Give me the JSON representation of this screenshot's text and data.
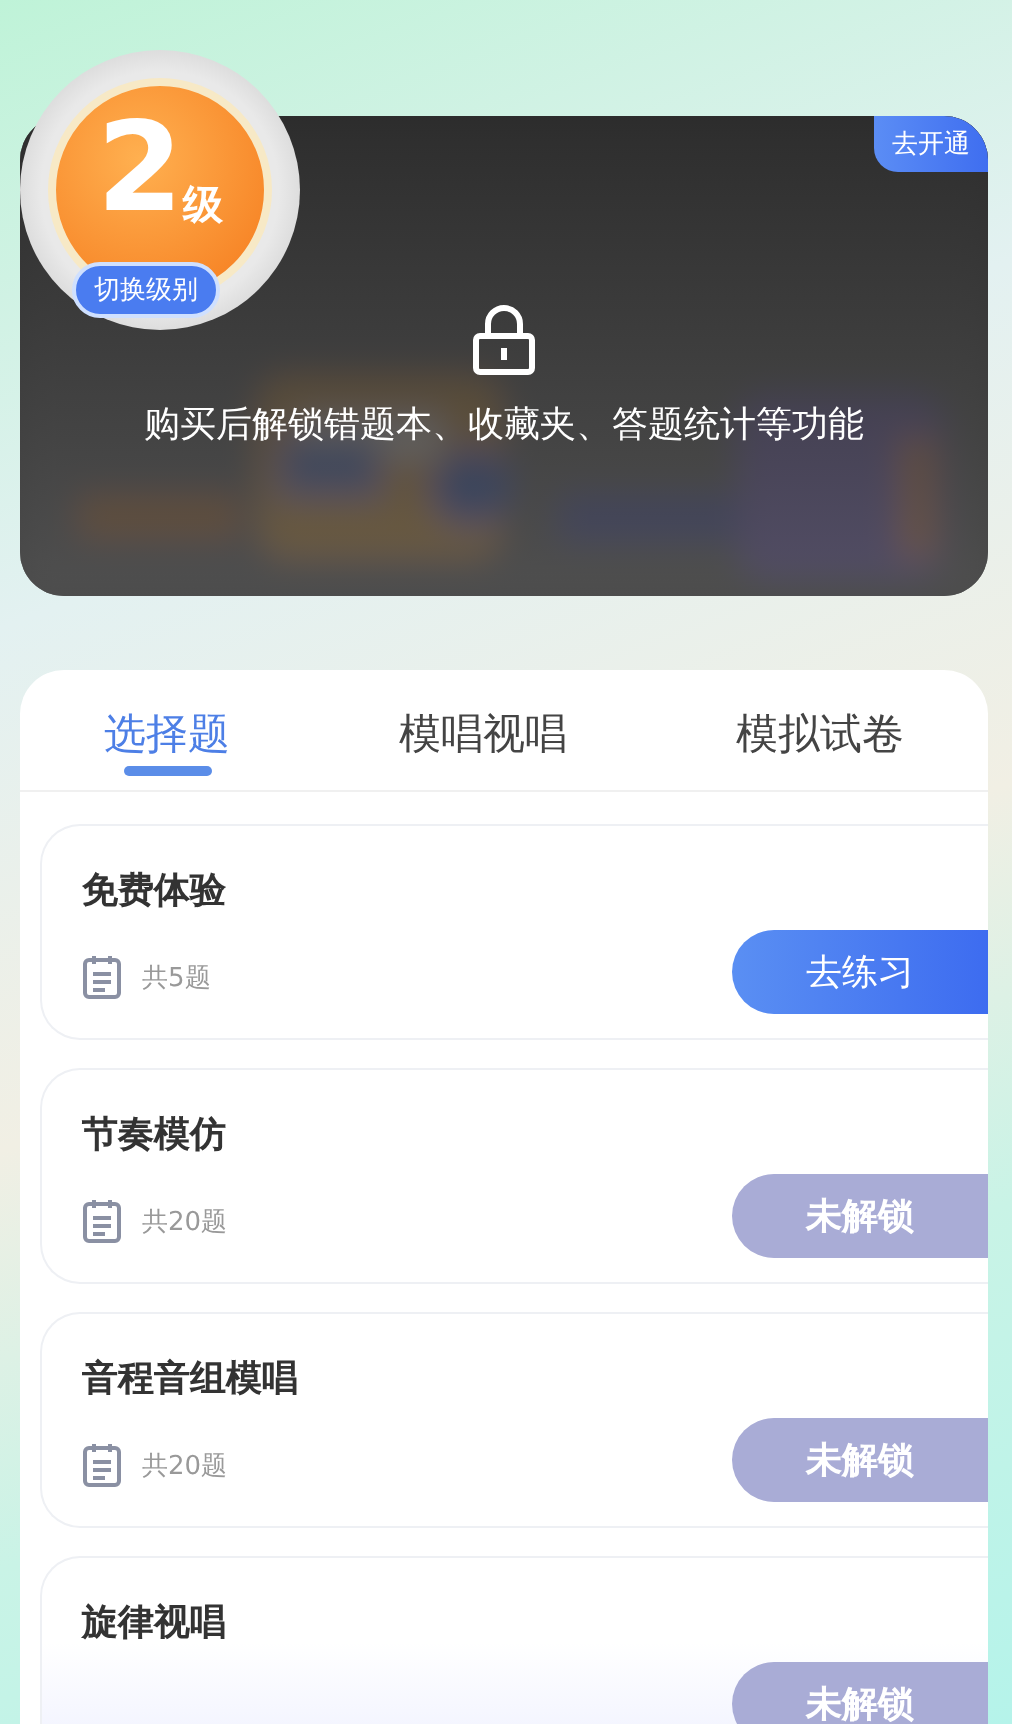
{
  "level_badge": {
    "number": "2",
    "unit": "级",
    "switch_label": "切换级别"
  },
  "banner": {
    "kind": "picture",
    "open_button": "去开通",
    "locked": true,
    "message": "购买后解锁错题本、收藏夹、答题统计等功能"
  },
  "tabs": [
    {
      "label": "选择题",
      "selected": true
    },
    {
      "label": "模唱视唱",
      "selected": false
    },
    {
      "label": "模拟试卷",
      "selected": false
    }
  ],
  "sets": [
    {
      "title": "免费体验",
      "count": "共5题",
      "button": "去练习",
      "locked": false
    },
    {
      "title": "节奏模仿",
      "count": "共20题",
      "button": "未解锁",
      "locked": true
    },
    {
      "title": "音程音组模唱",
      "count": "共20题",
      "button": "未解锁",
      "locked": true
    },
    {
      "title": "旋律视唱",
      "button": "未解锁",
      "locked": true
    }
  ]
}
